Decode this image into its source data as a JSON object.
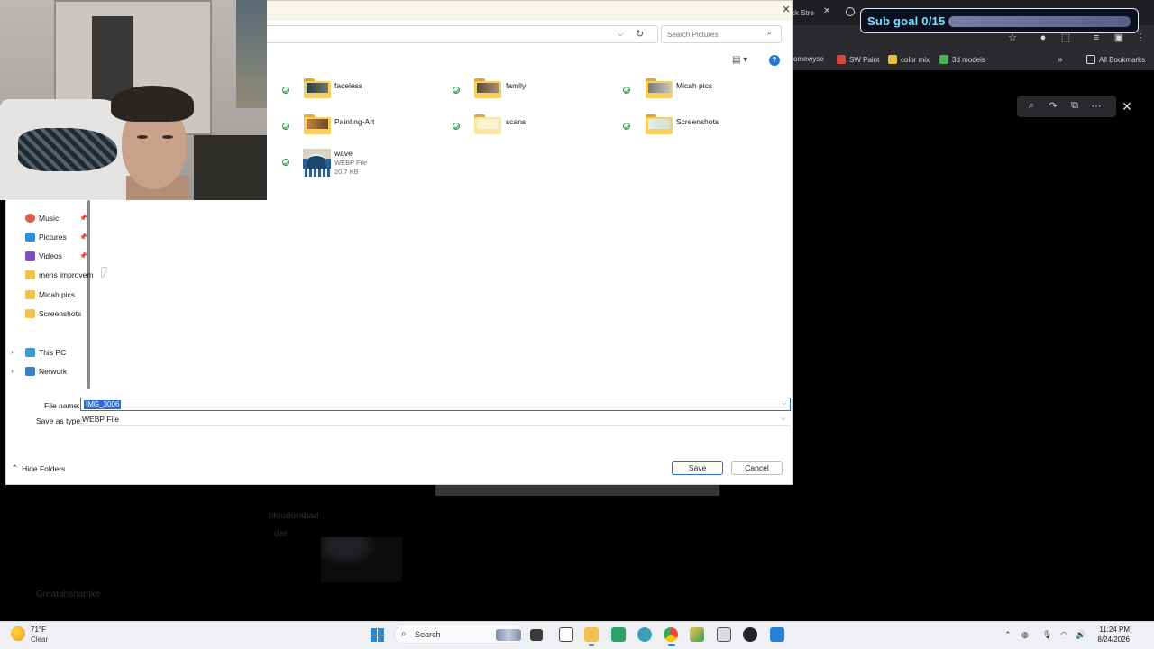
{
  "browser": {
    "tab_fragment": "ck Stre",
    "bookmarks": [
      {
        "label": "omewyse",
        "color": "#444"
      },
      {
        "label": "SW Paint",
        "color": "#d44"
      },
      {
        "label": "color mix",
        "color": "#e6c23a"
      },
      {
        "label": "3d models",
        "color": "#4caf50"
      }
    ],
    "all_bookmarks": "All Bookmarks",
    "bg_text_1": "bloodorabad",
    "bg_text_2": "dat",
    "bg_text_3": "Greatahshamke"
  },
  "overlay": {
    "sub_goal_label": "Sub goal 0/15",
    "sub_goal_progress": 0
  },
  "dialog": {
    "search_placeholder": "Search Pictures",
    "items": [
      {
        "name": "faceless",
        "type": "folder"
      },
      {
        "name": "family",
        "type": "folder"
      },
      {
        "name": "Micah pics",
        "type": "folder"
      },
      {
        "name": "Painting-Art",
        "type": "folder"
      },
      {
        "name": "scans",
        "type": "folder"
      },
      {
        "name": "Screenshots",
        "type": "folder"
      },
      {
        "name": "wave",
        "type": "file",
        "kind": "WEBP File",
        "size": "20.7 KB"
      }
    ],
    "nav": [
      {
        "label": "Music",
        "pinned": true,
        "color": "#e05a47"
      },
      {
        "label": "Pictures",
        "pinned": true,
        "color": "#2f8fd8"
      },
      {
        "label": "Videos",
        "pinned": true,
        "color": "#7a4fc4"
      },
      {
        "label": "mens improvem",
        "pinned": false,
        "color": "#f2c14e"
      },
      {
        "label": "Micah pics",
        "pinned": false,
        "color": "#f2c14e"
      },
      {
        "label": "Screenshots",
        "pinned": false,
        "color": "#f2c14e"
      },
      {
        "label": "This PC",
        "pinned": false,
        "color": "#3a9bd5"
      },
      {
        "label": "Network",
        "pinned": false,
        "color": "#3a7fc5"
      }
    ],
    "file_name_label": "File name:",
    "file_name_value": "IMG_3006",
    "save_type_label": "Save as type:",
    "save_type_value": "WEBP File",
    "hide_folders": "Hide Folders",
    "save": "Save",
    "cancel": "Cancel"
  },
  "taskbar": {
    "temp": "71°F",
    "condition": "Clear",
    "search": "Search",
    "time": "11:24 PM",
    "date": "8/24/2026"
  }
}
